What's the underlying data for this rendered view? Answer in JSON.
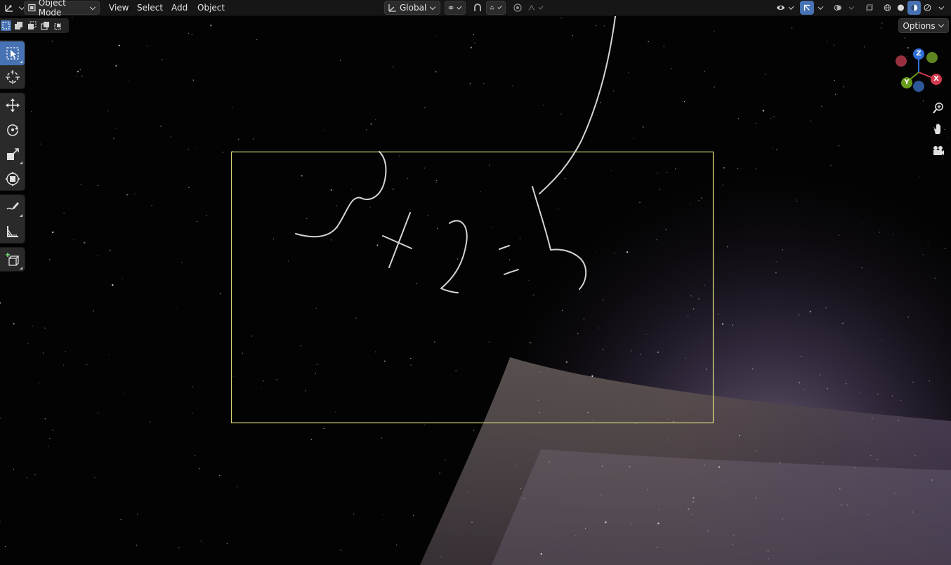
{
  "header": {
    "editor_type_icon": "axis-cursor-icon",
    "mode": {
      "label": "Object Mode",
      "icon": "object-mode-icon"
    },
    "menus": [
      "View",
      "Select",
      "Add",
      "Object"
    ],
    "transform_orientation": {
      "label": "Global",
      "icon": "orientation-axes-icon"
    },
    "pivot_icon": "pivot-link-icon",
    "snap_icon": "magnet-icon",
    "snap_target_icon": "snap-increment-icon",
    "proportional_icon": "proportional-editing-icon",
    "falloff_icon": "falloff-curve-icon",
    "right_icons": [
      "visibility-eye-icon",
      "gizmo-arrow-icon",
      "overlay-icon",
      "xray-icon",
      "wireframe-shading-icon",
      "solid-shading-icon",
      "material-shading-icon",
      "rendered-shading-icon"
    ]
  },
  "select_modes": [
    "select-new-icon",
    "select-extend-icon",
    "select-subtract-icon",
    "select-invert-icon",
    "select-intersect-icon"
  ],
  "options": {
    "label": "Options"
  },
  "toolbar": [
    {
      "name": "select-box",
      "icon": "select-cursor-icon",
      "active": true
    },
    {
      "name": "cursor",
      "icon": "3d-cursor-icon",
      "active": false
    },
    {
      "name": "move",
      "icon": "move-arrows-icon",
      "active": false
    },
    {
      "name": "rotate",
      "icon": "rotate-icon",
      "active": false
    },
    {
      "name": "scale",
      "icon": "scale-icon",
      "active": false
    },
    {
      "name": "transform",
      "icon": "transform-icon",
      "active": false
    },
    {
      "name": "annotate",
      "icon": "annotate-pen-icon",
      "active": false
    },
    {
      "name": "measure",
      "icon": "measure-ruler-icon",
      "active": false
    },
    {
      "name": "add-cube",
      "icon": "add-cube-icon",
      "active": false
    }
  ],
  "gizmo": {
    "axes": [
      {
        "label": "Z",
        "color": "#2f6fd6"
      },
      {
        "label": "X",
        "color": "#d33a4e"
      },
      {
        "label": "Y",
        "color": "#6a9c1c"
      }
    ],
    "neg_colors": {
      "x": "#b33a4a",
      "y": "#6f9d26",
      "z": "#3566b0"
    }
  },
  "nav_buttons": [
    "zoom-icon",
    "pan-hand-icon",
    "camera-view-icon"
  ],
  "colors": {
    "accent": "#4772b3",
    "camera_frame": "#d2d278",
    "sketch_stroke": "#cfcfcf",
    "planet_surface": "#5e5450",
    "atmosphere_glow": "#7a6a8a"
  }
}
